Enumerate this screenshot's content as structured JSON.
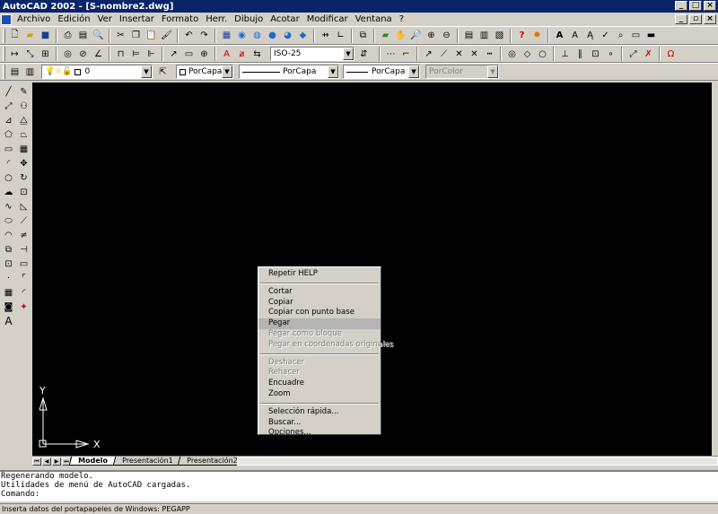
{
  "window": {
    "title": "AutoCAD 2002 - [S-nombre2.dwg]"
  },
  "menu": [
    "Archivo",
    "Edición",
    "Ver",
    "Insertar",
    "Formato",
    "Herr.",
    "Dibujo",
    "Acotar",
    "Modificar",
    "Ventana",
    "?"
  ],
  "layer": {
    "value": "0"
  },
  "color": {
    "value": "PorCapa"
  },
  "linetype": {
    "value": "PorCapa"
  },
  "lineweight": {
    "value": "PorCapa"
  },
  "plotstyle": {
    "value": "PorColor"
  },
  "dimstyle": {
    "value": "ISO-25"
  },
  "ucs": {
    "y_label": "Y",
    "x_label": "X"
  },
  "tabs": [
    "Modelo",
    "Presentación1",
    "Presentación2"
  ],
  "context_menu": {
    "repeat": "Repetir HELP",
    "cut": "Cortar",
    "copy": "Copiar",
    "copy_base": "Copiar con punto base",
    "paste": "Pegar",
    "paste_block": "Pegar como bloque",
    "paste_coords": "Pegar en coordenadas originales",
    "undo": "Deshacer",
    "redo": "Rehacer",
    "pan": "Encuadre",
    "zoom": "Zoom",
    "quick_select": "Selección rápida...",
    "find": "Buscar...",
    "options": "Opciones..."
  },
  "command": {
    "line1": "Regenerando modelo.",
    "line2": "Utilidades de menú de AutoCAD cargadas.",
    "prompt": "Comando:"
  },
  "status": {
    "text": "Inserta datos del portapapeles de Windows: PEGAPP"
  },
  "colors": {
    "canvas": "#000000",
    "titlebar": "#0a246a",
    "chrome": "#d4d0c8"
  }
}
